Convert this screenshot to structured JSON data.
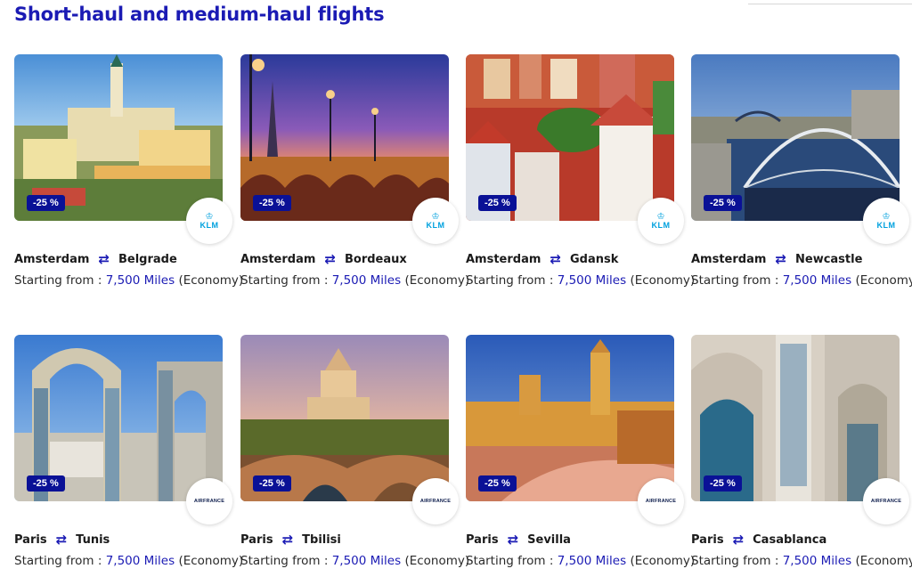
{
  "page": {
    "title": "Short-haul and medium-haul flights"
  },
  "cards": [
    {
      "discount": "-25 %",
      "airline": "KLM",
      "origin": "Amsterdam",
      "destination": "Belgrade",
      "price_prefix": "Starting from :",
      "miles": "7,500 Miles",
      "cabin": "(Economy)"
    },
    {
      "discount": "-25 %",
      "airline": "KLM",
      "origin": "Amsterdam",
      "destination": "Bordeaux",
      "price_prefix": "Starting from :",
      "miles": "7,500 Miles",
      "cabin": "(Economy)"
    },
    {
      "discount": "-25 %",
      "airline": "KLM",
      "origin": "Amsterdam",
      "destination": "Gdansk",
      "price_prefix": "Starting from :",
      "miles": "7,500 Miles",
      "cabin": "(Economy)"
    },
    {
      "discount": "-25 %",
      "airline": "KLM",
      "origin": "Amsterdam",
      "destination": "Newcastle",
      "price_prefix": "Starting from :",
      "miles": "7,500 Miles",
      "cabin": "(Economy)"
    },
    {
      "discount": "-25 %",
      "airline": "AIRFRANCE",
      "origin": "Paris",
      "destination": "Tunis",
      "price_prefix": "Starting from :",
      "miles": "7,500 Miles",
      "cabin": "(Economy)"
    },
    {
      "discount": "-25 %",
      "airline": "AIRFRANCE",
      "origin": "Paris",
      "destination": "Tbilisi",
      "price_prefix": "Starting from :",
      "miles": "7,500 Miles",
      "cabin": "(Economy)"
    },
    {
      "discount": "-25 %",
      "airline": "AIRFRANCE",
      "origin": "Paris",
      "destination": "Sevilla",
      "price_prefix": "Starting from :",
      "miles": "7,500 Miles",
      "cabin": "(Economy)"
    },
    {
      "discount": "-25 %",
      "airline": "AIRFRANCE",
      "origin": "Paris",
      "destination": "Casablanca",
      "price_prefix": "Starting from :",
      "miles": "7,500 Miles",
      "cabin": "(Economy)"
    }
  ],
  "icons": {
    "swap": "swap-arrows-icon",
    "klm_crown": "klm-crown-icon"
  },
  "colors": {
    "brand_blue": "#1b1bb4",
    "discount_bg": "#0a1196",
    "klm_blue": "#00a1de"
  }
}
